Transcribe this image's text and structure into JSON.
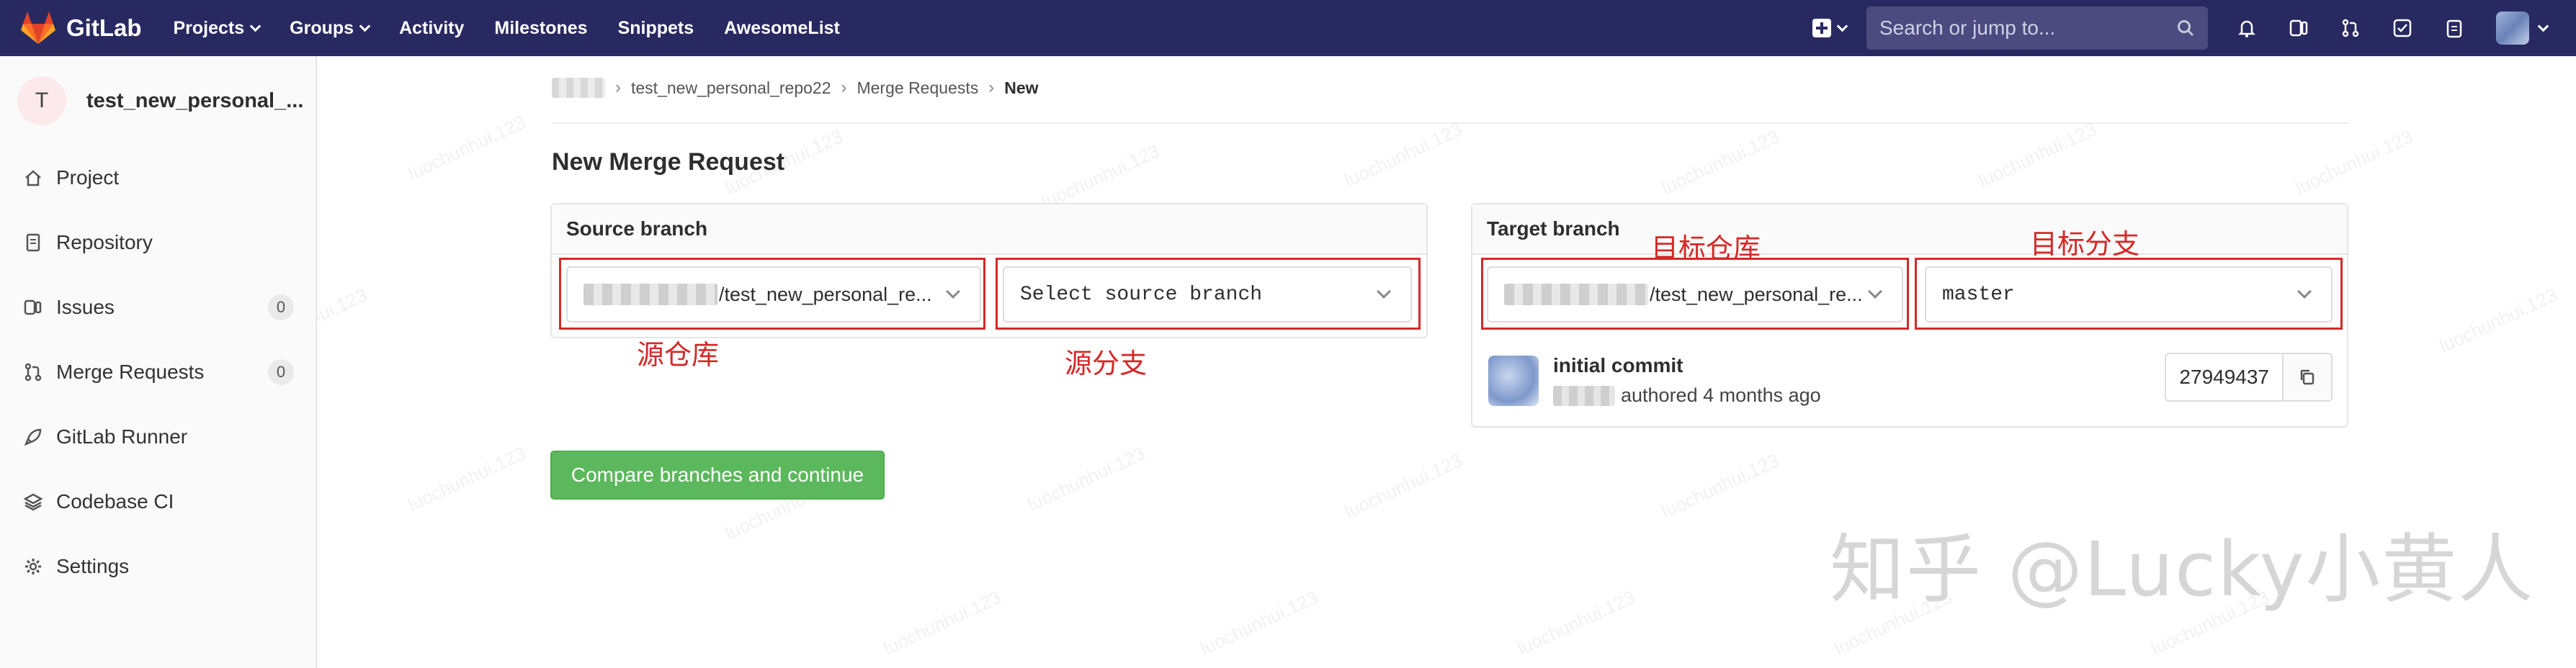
{
  "navbar": {
    "brand": "GitLab",
    "items": [
      {
        "label": "Projects",
        "dropdown": true
      },
      {
        "label": "Groups",
        "dropdown": true
      },
      {
        "label": "Activity",
        "dropdown": false
      },
      {
        "label": "Milestones",
        "dropdown": false
      },
      {
        "label": "Snippets",
        "dropdown": false
      },
      {
        "label": "AwesomeList",
        "dropdown": false
      }
    ],
    "search_placeholder": "Search or jump to...",
    "bg_color": "#292961"
  },
  "sidebar": {
    "project_initial": "T",
    "project_name": "test_new_personal_...",
    "items": [
      {
        "label": "Project",
        "icon": "home-icon"
      },
      {
        "label": "Repository",
        "icon": "document-icon"
      },
      {
        "label": "Issues",
        "icon": "issues-icon",
        "count": "0"
      },
      {
        "label": "Merge Requests",
        "icon": "merge-request-icon",
        "count": "0"
      },
      {
        "label": "GitLab Runner",
        "icon": "rocket-icon"
      },
      {
        "label": "Codebase CI",
        "icon": "layers-icon"
      },
      {
        "label": "Settings",
        "icon": "gear-icon"
      }
    ]
  },
  "breadcrumb": {
    "items": [
      "test_new_personal_repo22",
      "Merge Requests"
    ],
    "current": "New"
  },
  "page_title": "New Merge Request",
  "source": {
    "header": "Source branch",
    "project_value": "/test_new_personal_re...",
    "branch_placeholder": "Select source branch",
    "annotation_project": "源仓库",
    "annotation_branch": "源分支"
  },
  "target": {
    "header": "Target branch",
    "project_value": "/test_new_personal_re...",
    "branch_value": "master",
    "annotation_project": "目标仓库",
    "annotation_branch": "目标分支"
  },
  "commit": {
    "title": "initial commit",
    "meta": "authored 4 months ago",
    "sha": "27949437"
  },
  "compare_button": "Compare branches and continue",
  "watermark_text": "luochunhui.123",
  "zhihu_watermark": "知乎 @Lucky小黄人",
  "colors": {
    "accent_green": "#5cb85c",
    "annotation_red": "#d62828"
  }
}
